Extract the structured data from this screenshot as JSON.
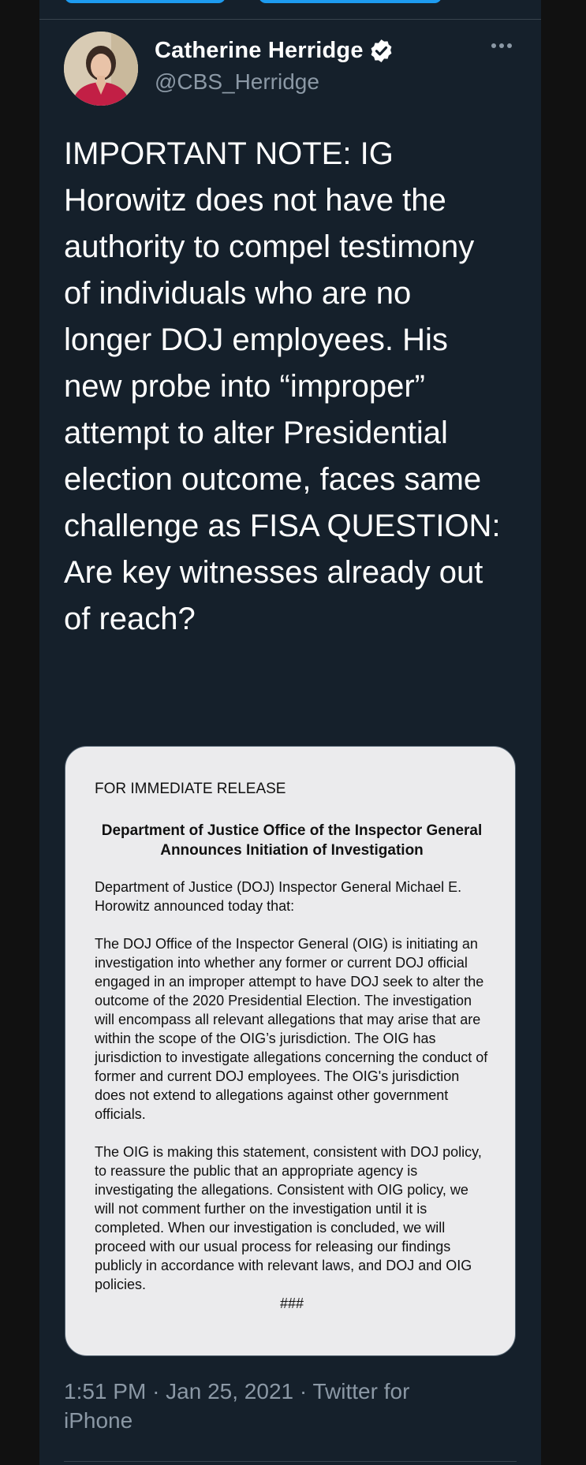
{
  "tweet": {
    "author_name": "Catherine Herridge",
    "author_handle": "@CBS_Herridge",
    "text": "IMPORTANT NOTE: IG Horowitz does not have the authority to compel testimony of individuals who are no longer DOJ employees. His new probe into “improper” attempt to alter Presidential election outcome, faces same challenge as FISA QUESTION: Are key witnesses already out of reach?",
    "time": "1:51 PM",
    "date": "Jan 25, 2021",
    "source": "Twitter for iPhone",
    "meta_sep": "·"
  },
  "document": {
    "header": "FOR IMMEDIATE RELEASE",
    "title": "Department of Justice Office of the Inspector General Announces Initiation of Investigation",
    "paragraphs": [
      "Department of Justice (DOJ) Inspector General Michael E. Horowitz announced today that:",
      "The DOJ Office of the Inspector General (OIG) is initiating an investigation into whether any former or current DOJ official engaged in an improper attempt to have DOJ seek to alter the outcome of the 2020 Presidential Election.  The investigation will encompass all relevant allegations that may arise that are within the scope of the OIG’s jurisdiction.  The OIG has jurisdiction to investigate allegations concerning the conduct of former and current DOJ employees.  The OIG's jurisdiction does not extend to allegations against other government officials.",
      "The OIG is making this statement, consistent with DOJ policy, to reassure the public that an appropriate agency is investigating the allegations.  Consistent with OIG policy, we will not comment further on the investigation until it is completed.  When our investigation is concluded, we will proceed with our usual process for releasing our findings publicly in accordance with relevant laws, and DOJ and OIG policies."
    ],
    "end_mark": "###"
  },
  "icons": {
    "verified": "verified-badge-icon",
    "more": "more-options-icon"
  },
  "colors": {
    "background": "#15202b",
    "text": "#ffffff",
    "secondary": "#8b98a5",
    "accent": "#1d9bf0"
  }
}
